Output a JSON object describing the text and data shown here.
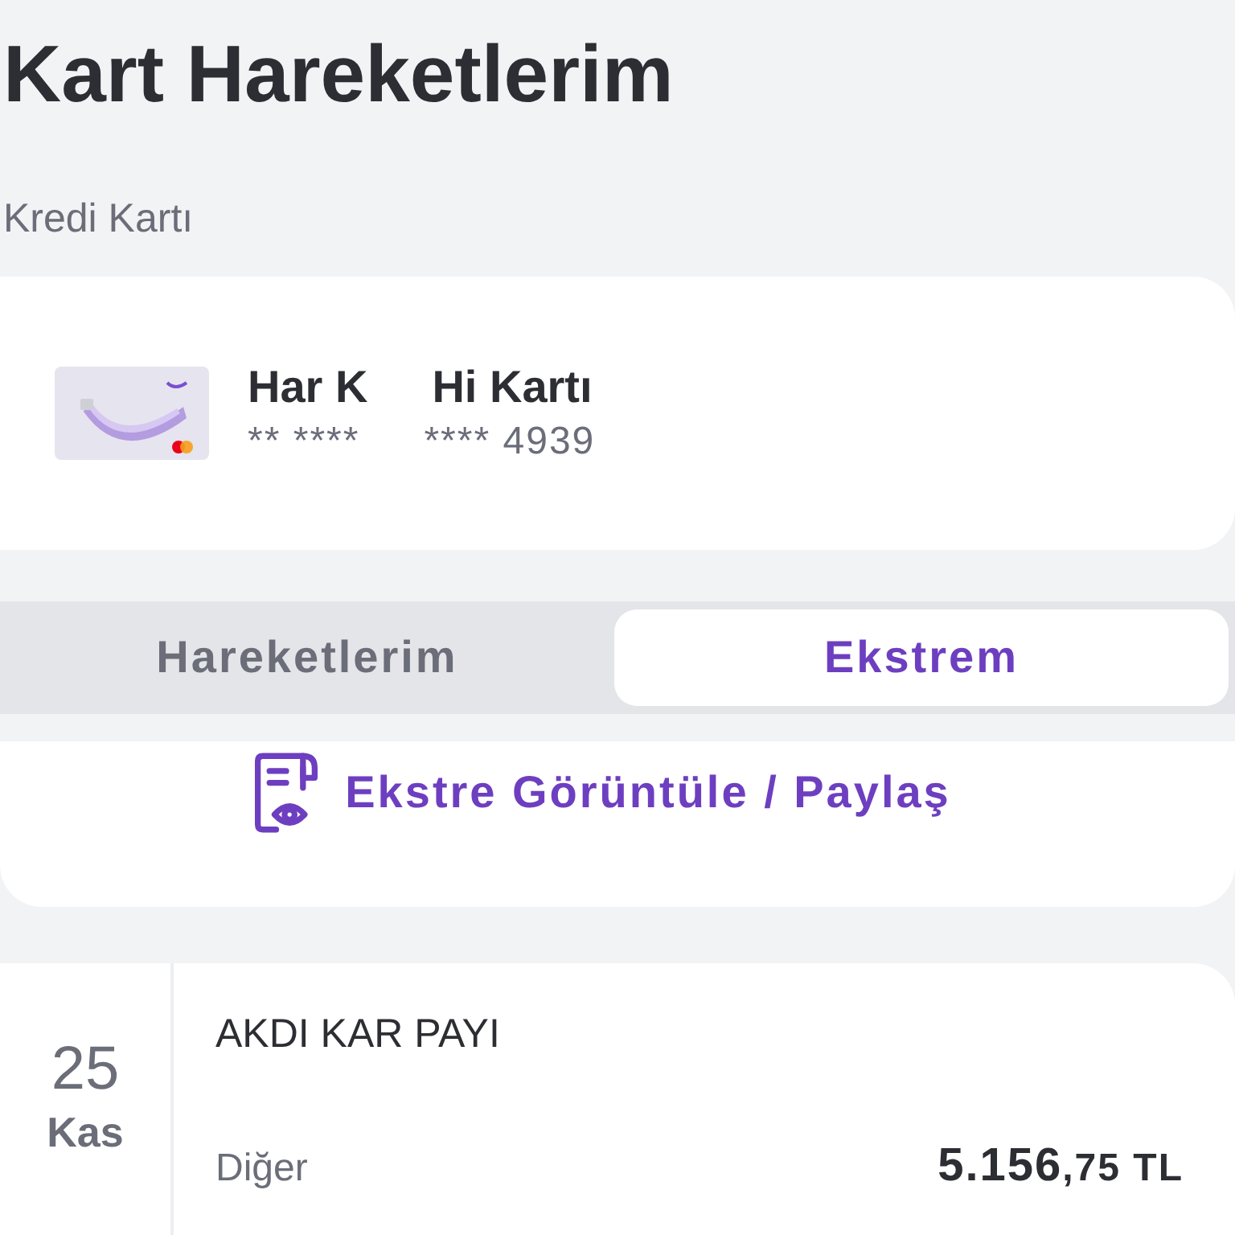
{
  "title": "Kart Hareketlerim",
  "section_label": "Kredi Kartı",
  "card": {
    "kind": "picture",
    "name_parts": [
      "Har K",
      "Hi Kartı"
    ],
    "number_parts": [
      "** ****",
      "**** 4939"
    ]
  },
  "tabs": [
    {
      "label": "Hareketlerim",
      "selected": false
    },
    {
      "label": "Ekstrem",
      "selected": true
    }
  ],
  "statement_action": "Ekstre Görüntüle / Paylaş",
  "transactions": [
    {
      "day": "25",
      "month": "Kas",
      "description": "AKDI KAR PAYI",
      "category": "Diğer",
      "amount_main": "5.156",
      "amount_fraction": ",75 TL"
    }
  ]
}
